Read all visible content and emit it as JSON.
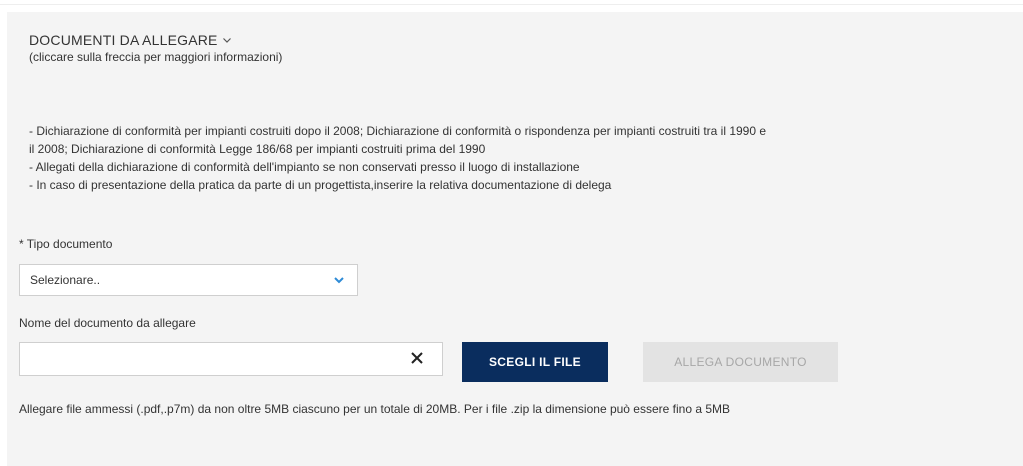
{
  "section": {
    "title": "DOCUMENTI DA ALLEGARE",
    "hint": "(cliccare sulla freccia per maggiori informazioni)",
    "documents": [
      "- Dichiarazione di conformità per impianti costruiti dopo il 2008; Dichiarazione di conformità o rispondenza per impianti costruiti tra il 1990 e",
      "il 2008; Dichiarazione di conformità Legge 186/68 per impianti costruiti prima del 1990",
      "- Allegati della dichiarazione di conformità dell'impianto se non conservati presso il luogo di installazione",
      "- In caso di presentazione della pratica da parte di un progettista,inserire la relativa documentazione di delega"
    ]
  },
  "form": {
    "doc_type_label": "* Tipo documento",
    "doc_type_selected": "Selezionare..",
    "doc_name_label": "Nome del documento da allegare",
    "doc_name_value": "",
    "choose_file_button": "SCEGLI IL FILE",
    "attach_button": "ALLEGA DOCUMENTO",
    "note": "Allegare file ammessi (.pdf,.p7m) da non oltre 5MB ciascuno per un totale di 20MB. Per i file .zip la dimensione può essere fino a 5MB"
  },
  "colors": {
    "primary": "#0a2d5e",
    "select_chevron": "#2e8bd6",
    "disabled_bg": "#e3e3e3",
    "disabled_text": "#a7a7a7",
    "panel_bg": "#f4f4f4"
  },
  "icons": {
    "title_toggle": "chevron-down-icon",
    "select_toggle": "chevron-down-icon",
    "clear": "close-icon"
  }
}
